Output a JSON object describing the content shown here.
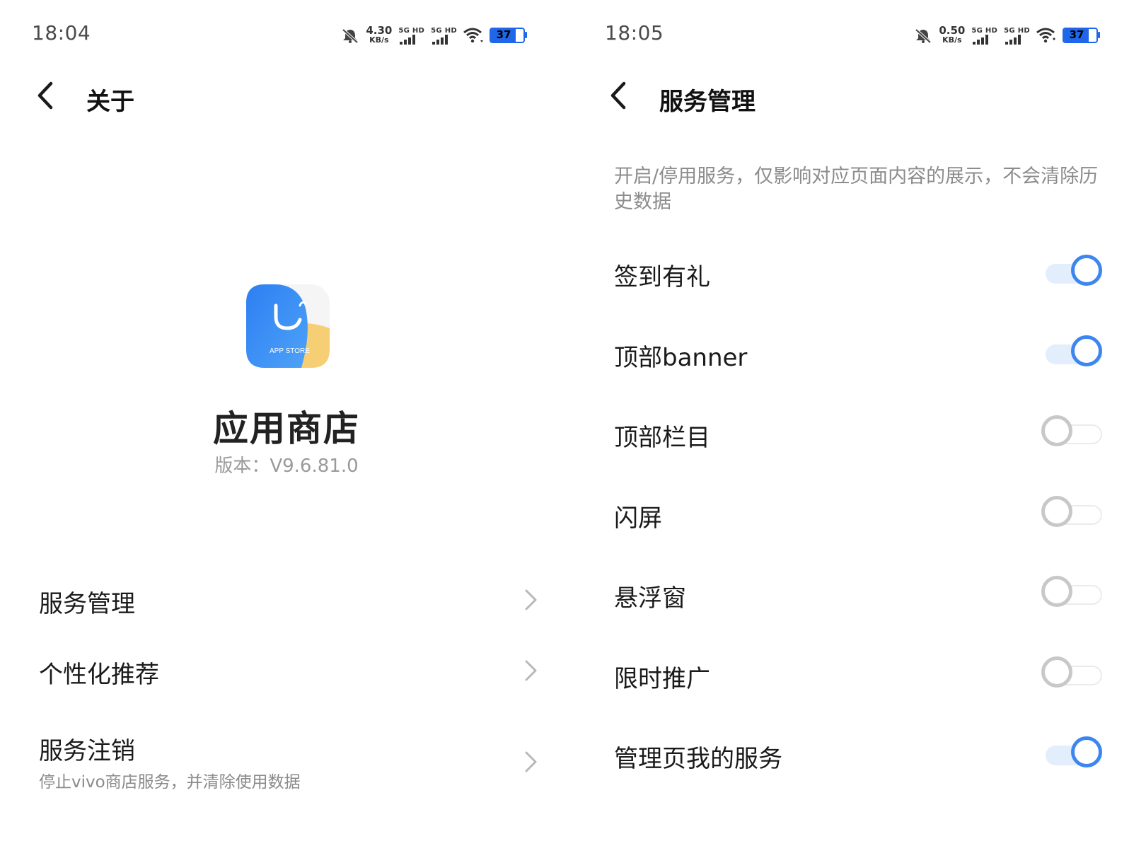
{
  "left_screen": {
    "status_bar": {
      "time": "18:04",
      "net_speed": "4.30",
      "net_unit": "KB/s",
      "sim1_label": "5G HD",
      "sim2_label": "5G HD",
      "battery": "37"
    },
    "header": {
      "title": "关于"
    },
    "app": {
      "name": "应用商店",
      "version": "版本：V9.6.81.0",
      "icon_text": "APP STORE"
    },
    "menu": [
      {
        "label": "服务管理"
      },
      {
        "label": "个性化推荐"
      },
      {
        "label": "服务注销",
        "sublabel": "停止vivo商店服务，并清除使用数据"
      }
    ]
  },
  "right_screen": {
    "status_bar": {
      "time": "18:05",
      "net_speed": "0.50",
      "net_unit": "KB/s",
      "sim1_label": "5G HD",
      "sim2_label": "5G HD",
      "battery": "37"
    },
    "header": {
      "title": "服务管理"
    },
    "description": "开启/停用服务，仅影响对应页面内容的展示，不会清除历史数据",
    "services": [
      {
        "label": "签到有礼",
        "enabled": true
      },
      {
        "label": "顶部banner",
        "enabled": true
      },
      {
        "label": "顶部栏目",
        "enabled": false
      },
      {
        "label": "闪屏",
        "enabled": false
      },
      {
        "label": "悬浮窗",
        "enabled": false
      },
      {
        "label": "限时推广",
        "enabled": false
      },
      {
        "label": "管理页我的服务",
        "enabled": true
      }
    ]
  },
  "colors": {
    "accent": "#3d86f0",
    "battery": "#1f66e8",
    "toggle_off": "#c8c8c8"
  },
  "icons": [
    "mute-icon",
    "signal-icon",
    "wifi-icon",
    "battery-icon",
    "back-arrow-icon",
    "chevron-right-icon",
    "app-store-icon"
  ]
}
